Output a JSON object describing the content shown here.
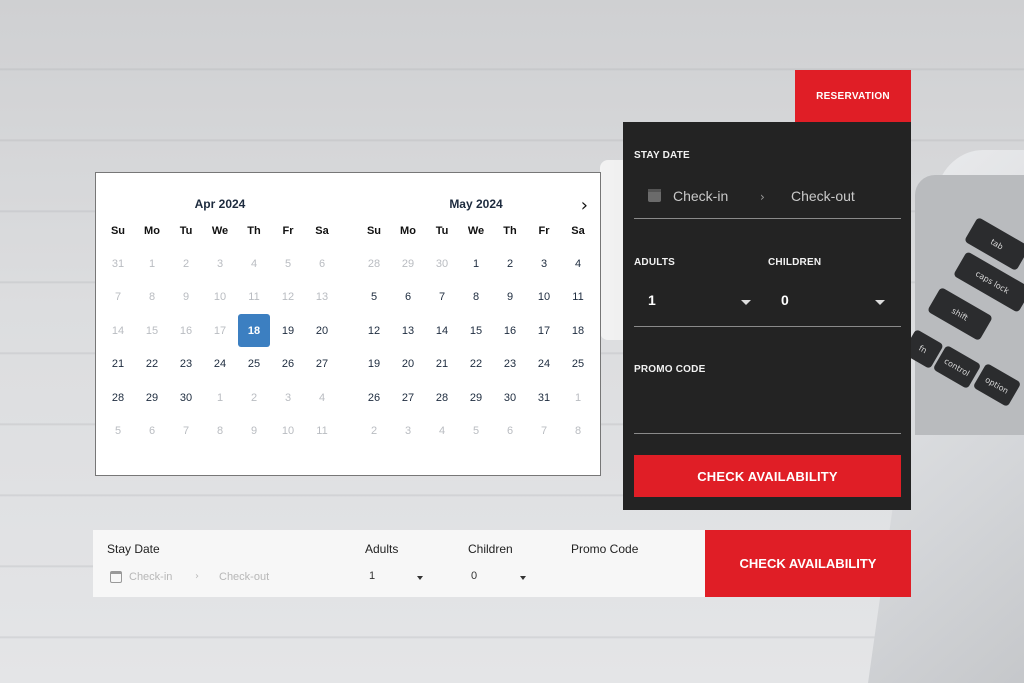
{
  "calendar": {
    "weekdays": [
      "Su",
      "Mo",
      "Tu",
      "We",
      "Th",
      "Fr",
      "Sa"
    ],
    "months": [
      {
        "title": "Apr 2024",
        "weeks": [
          [
            {
              "d": "31",
              "m": true
            },
            {
              "d": "1",
              "m": true
            },
            {
              "d": "2",
              "m": true
            },
            {
              "d": "3",
              "m": true
            },
            {
              "d": "4",
              "m": true
            },
            {
              "d": "5",
              "m": true
            },
            {
              "d": "6",
              "m": true
            }
          ],
          [
            {
              "d": "7",
              "m": true
            },
            {
              "d": "8",
              "m": true
            },
            {
              "d": "9",
              "m": true
            },
            {
              "d": "10",
              "m": true
            },
            {
              "d": "11",
              "m": true
            },
            {
              "d": "12",
              "m": true
            },
            {
              "d": "13",
              "m": true
            }
          ],
          [
            {
              "d": "14",
              "m": true
            },
            {
              "d": "15",
              "m": true
            },
            {
              "d": "16",
              "m": true
            },
            {
              "d": "17",
              "m": true
            },
            {
              "d": "18",
              "s": true
            },
            {
              "d": "19"
            },
            {
              "d": "20"
            }
          ],
          [
            {
              "d": "21"
            },
            {
              "d": "22"
            },
            {
              "d": "23"
            },
            {
              "d": "24"
            },
            {
              "d": "25"
            },
            {
              "d": "26"
            },
            {
              "d": "27"
            }
          ],
          [
            {
              "d": "28"
            },
            {
              "d": "29"
            },
            {
              "d": "30"
            },
            {
              "d": "1",
              "m": true
            },
            {
              "d": "2",
              "m": true
            },
            {
              "d": "3",
              "m": true
            },
            {
              "d": "4",
              "m": true
            }
          ],
          [
            {
              "d": "5",
              "m": true
            },
            {
              "d": "6",
              "m": true
            },
            {
              "d": "7",
              "m": true
            },
            {
              "d": "8",
              "m": true
            },
            {
              "d": "9",
              "m": true
            },
            {
              "d": "10",
              "m": true
            },
            {
              "d": "11",
              "m": true
            }
          ]
        ]
      },
      {
        "title": "May 2024",
        "weeks": [
          [
            {
              "d": "28",
              "m": true
            },
            {
              "d": "29",
              "m": true
            },
            {
              "d": "30",
              "m": true
            },
            {
              "d": "1"
            },
            {
              "d": "2"
            },
            {
              "d": "3"
            },
            {
              "d": "4"
            }
          ],
          [
            {
              "d": "5"
            },
            {
              "d": "6"
            },
            {
              "d": "7"
            },
            {
              "d": "8"
            },
            {
              "d": "9"
            },
            {
              "d": "10"
            },
            {
              "d": "11"
            }
          ],
          [
            {
              "d": "12"
            },
            {
              "d": "13"
            },
            {
              "d": "14"
            },
            {
              "d": "15"
            },
            {
              "d": "16"
            },
            {
              "d": "17"
            },
            {
              "d": "18"
            }
          ],
          [
            {
              "d": "19"
            },
            {
              "d": "20"
            },
            {
              "d": "21"
            },
            {
              "d": "22"
            },
            {
              "d": "23"
            },
            {
              "d": "24"
            },
            {
              "d": "25"
            }
          ],
          [
            {
              "d": "26"
            },
            {
              "d": "27"
            },
            {
              "d": "28"
            },
            {
              "d": "29"
            },
            {
              "d": "30"
            },
            {
              "d": "31"
            },
            {
              "d": "1",
              "m": true
            }
          ],
          [
            {
              "d": "2",
              "m": true
            },
            {
              "d": "3",
              "m": true
            },
            {
              "d": "4",
              "m": true
            },
            {
              "d": "5",
              "m": true
            },
            {
              "d": "6",
              "m": true
            },
            {
              "d": "7",
              "m": true
            },
            {
              "d": "8",
              "m": true
            }
          ]
        ]
      }
    ],
    "next_icon": "chevron-right-icon"
  },
  "reservation_panel": {
    "tab_label": "RESERVATION",
    "stay_date_label": "STAY DATE",
    "checkin_placeholder": "Check-in",
    "separator": "›",
    "checkout_placeholder": "Check-out",
    "adults_label": "ADULTS",
    "adults_value": "1",
    "children_label": "CHILDREN",
    "children_value": "0",
    "promo_label": "PROMO CODE",
    "button_label": "CHECK AVAILABILITY"
  },
  "booking_bar": {
    "stay_date_label": "Stay Date",
    "checkin_placeholder": "Check-in",
    "separator": "›",
    "checkout_placeholder": "Check-out",
    "adults_label": "Adults",
    "adults_value": "1",
    "children_label": "Children",
    "children_value": "0",
    "promo_label": "Promo Code",
    "button_label": "CHECK AVAILABILITY"
  },
  "laptop_keys": [
    "tab",
    "caps lock",
    "shift",
    "fn",
    "control",
    "option"
  ],
  "colors": {
    "accent": "#e01e26",
    "panel": "#232323",
    "selected_day": "#3c7fc1"
  }
}
